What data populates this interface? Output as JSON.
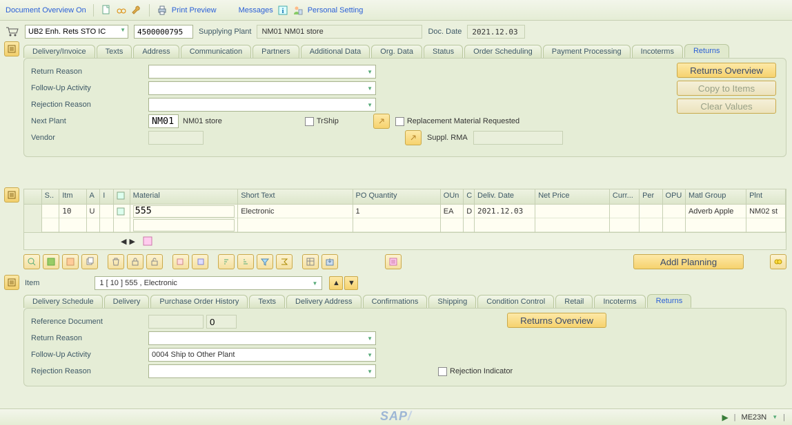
{
  "toolbar": {
    "doc_overview": "Document Overview On",
    "print_preview": "Print Preview",
    "messages": "Messages",
    "personal_setting": "Personal Setting"
  },
  "header": {
    "doc_type": "UB2 Enh. Rets STO IC",
    "doc_number": "4500000795",
    "supplying_plant_label": "Supplying Plant",
    "supplying_plant_value": "NM01 NM01 store",
    "doc_date_label": "Doc. Date",
    "doc_date_value": "2021.12.03"
  },
  "header_tabs": [
    "Delivery/Invoice",
    "Texts",
    "Address",
    "Communication",
    "Partners",
    "Additional Data",
    "Org. Data",
    "Status",
    "Order Scheduling",
    "Payment Processing",
    "Incoterms",
    "Returns"
  ],
  "header_active_tab": 11,
  "returns_panel": {
    "return_reason_label": "Return Reason",
    "followup_label": "Follow-Up Activity",
    "rejection_label": "Rejection Reason",
    "next_plant_label": "Next Plant",
    "next_plant_code": "NM01",
    "next_plant_text": "NM01 store",
    "trship_label": "TrShip",
    "vendor_label": "Vendor",
    "replace_label": "Replacement Material Requested",
    "suppl_rma_label": "Suppl. RMA",
    "btn_overview": "Returns Overview",
    "btn_copy": "Copy to Items",
    "btn_clear": "Clear Values"
  },
  "grid": {
    "columns": [
      "S..",
      "Itm",
      "A",
      "I",
      "",
      "Material",
      "Short Text",
      "PO Quantity",
      "OUn",
      "C",
      "Deliv. Date",
      "Net Price",
      "Curr...",
      "Per",
      "OPU",
      "Matl Group",
      "Plnt"
    ],
    "widths": [
      26,
      40,
      20,
      20,
      24,
      160,
      170,
      130,
      34,
      16,
      90,
      110,
      44,
      34,
      34,
      90,
      58
    ],
    "rows": [
      {
        "s": "",
        "itm": "10",
        "a": "U",
        "i": "",
        "material": "555",
        "short": "Electronic",
        "qty": "1",
        "oun": "EA",
        "c": "D",
        "deliv": "2021.12.03",
        "net": "",
        "curr": "",
        "per": "",
        "opu": "",
        "matg": "Adverb Apple",
        "plnt": "NM02 st"
      }
    ]
  },
  "icobar": {
    "addl": "Addl Planning"
  },
  "item_head": {
    "label": "Item",
    "value": "1 [ 10 ] 555 , Electronic"
  },
  "item_tabs": [
    "Delivery Schedule",
    "Delivery",
    "Purchase Order History",
    "Texts",
    "Delivery Address",
    "Confirmations",
    "Shipping",
    "Condition Control",
    "Retail",
    "Incoterms",
    "Returns"
  ],
  "item_active_tab": 10,
  "item_panel": {
    "refdoc_label": "Reference Document",
    "refdoc_val1": "",
    "refdoc_val2": "0",
    "return_reason_label": "Return Reason",
    "followup_label": "Follow-Up Activity",
    "followup_value": "0004 Ship to Other Plant",
    "rejection_label": "Rejection Reason",
    "rej_ind_label": "Rejection Indicator",
    "btn_overview": "Returns Overview"
  },
  "status": {
    "tcode": "ME23N"
  }
}
